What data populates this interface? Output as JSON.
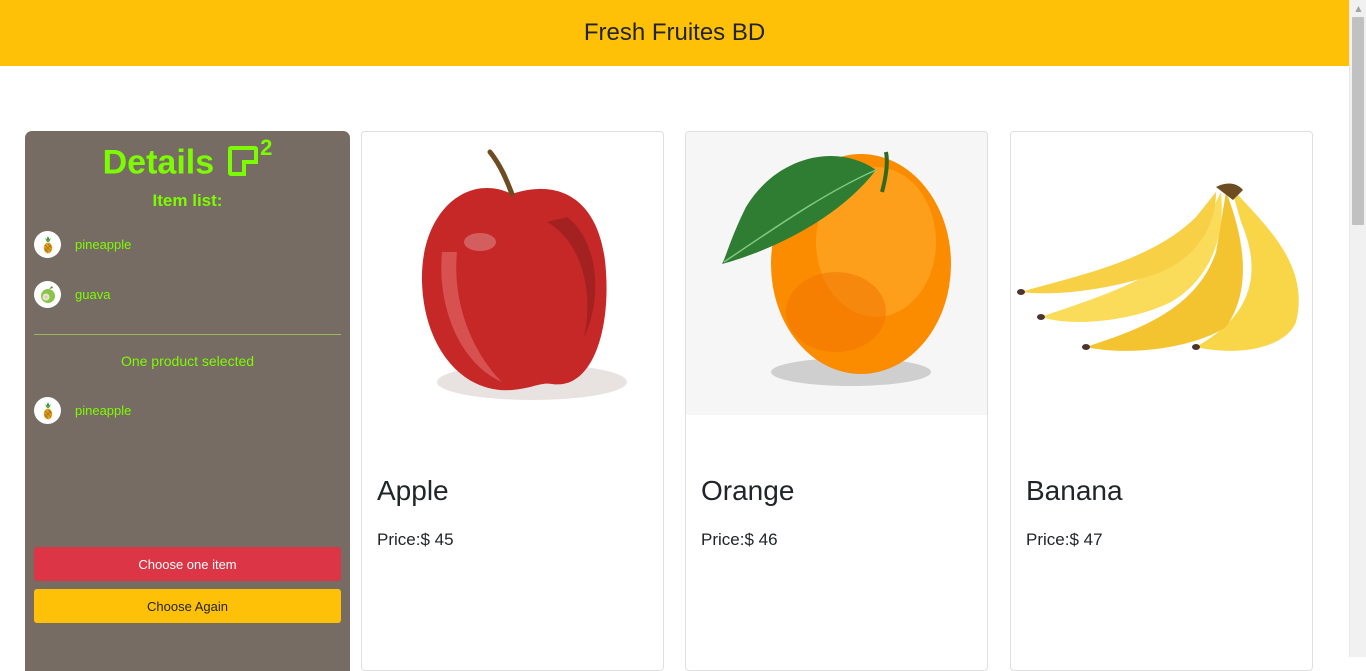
{
  "header": {
    "title": "Fresh Fruites BD",
    "bg_color": "#ffc107"
  },
  "sidebar": {
    "title": "Details",
    "count": "2",
    "item_list_label": "Item list:",
    "items": [
      {
        "name": "pineapple",
        "icon": "pineapple-icon"
      },
      {
        "name": "guava",
        "icon": "guava-icon"
      }
    ],
    "selected_message": "One product selected",
    "selected_items": [
      {
        "name": "pineapple",
        "icon": "pineapple-icon"
      }
    ],
    "choose_one_label": "Choose one item",
    "choose_again_label": "Choose Again",
    "accent_color": "#7cfc00",
    "bg_color": "#766c64"
  },
  "products": [
    {
      "name": "Apple",
      "price": "Price:$ 45",
      "image": "apple"
    },
    {
      "name": "Orange",
      "price": "Price:$ 46",
      "image": "orange"
    },
    {
      "name": "Banana",
      "price": "Price:$ 47",
      "image": "banana"
    }
  ]
}
